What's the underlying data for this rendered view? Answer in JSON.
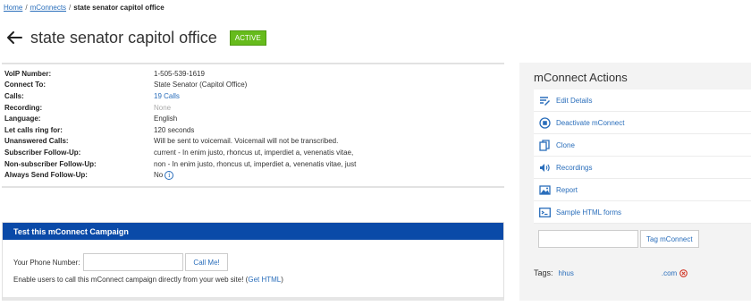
{
  "breadcrumb": {
    "home": "Home",
    "section": "mConnects",
    "current": "state senator capitol office"
  },
  "header": {
    "title": "state senator capitol office",
    "status": "ACTIVE",
    "status_color": "#66bb1c"
  },
  "details": [
    {
      "label": "VoIP Number:",
      "value": "1-505-539-1619"
    },
    {
      "label": "Connect To:",
      "value": "State Senator (Capitol Office)"
    },
    {
      "label": "Calls:",
      "value": "19 Calls"
    },
    {
      "label": "Recording:",
      "value": "None"
    },
    {
      "label": "Language:",
      "value": "English"
    },
    {
      "label": "Let calls ring for:",
      "value": "120 seconds"
    },
    {
      "label": "Unanswered Calls:",
      "value": "Will be sent to voicemail. Voicemail will not be transcribed."
    },
    {
      "label": "Subscriber Follow-Up:",
      "value": "current - In enim justo, rhoncus ut, imperdiet a, venenatis vitae,"
    },
    {
      "label": "Non-subscriber Follow-Up:",
      "value": "non - In enim justo, rhoncus ut, imperdiet a, venenatis vitae, just"
    },
    {
      "label": "Always Send Follow-Up:",
      "value": "No"
    }
  ],
  "test_campaign": {
    "title": "Test this mConnect Campaign",
    "phone_label": "Your Phone Number:",
    "phone_value": "",
    "call_button": "Call Me!",
    "enable_text": "Enable users to call this mConnect campaign directly from your web site! (",
    "get_html_link": "Get HTML",
    "enable_text_end": ")",
    "header_color": "#0a4aa8"
  },
  "actions": {
    "title": "mConnect Actions",
    "items": [
      {
        "label": "Edit Details",
        "icon": "edit-icon"
      },
      {
        "label": "Deactivate mConnect",
        "icon": "stop-icon"
      },
      {
        "label": "Clone",
        "icon": "clone-icon"
      },
      {
        "label": "Recordings",
        "icon": "speaker-icon"
      },
      {
        "label": "Report",
        "icon": "report-icon"
      },
      {
        "label": "Sample HTML forms",
        "icon": "terminal-icon"
      }
    ],
    "tag_input_value": "",
    "tag_button": "Tag mConnect",
    "tags_label": "Tags:",
    "tag_left": "hhus",
    "tag_right": ".com",
    "link_color": "#2a6ebb"
  }
}
